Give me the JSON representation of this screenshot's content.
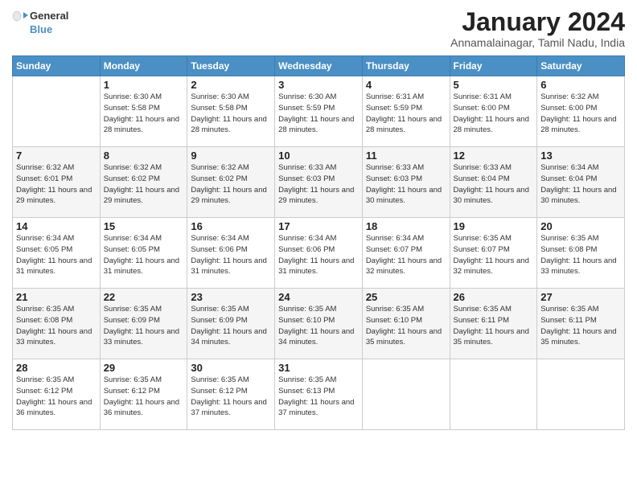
{
  "logo": {
    "line1": "General",
    "line2": "Blue"
  },
  "title": "January 2024",
  "location": "Annamalainagar, Tamil Nadu, India",
  "header": {
    "days": [
      "Sunday",
      "Monday",
      "Tuesday",
      "Wednesday",
      "Thursday",
      "Friday",
      "Saturday"
    ]
  },
  "weeks": [
    [
      {
        "day": "",
        "sunrise": "",
        "sunset": "",
        "daylight": ""
      },
      {
        "day": "1",
        "sunrise": "Sunrise: 6:30 AM",
        "sunset": "Sunset: 5:58 PM",
        "daylight": "Daylight: 11 hours and 28 minutes."
      },
      {
        "day": "2",
        "sunrise": "Sunrise: 6:30 AM",
        "sunset": "Sunset: 5:58 PM",
        "daylight": "Daylight: 11 hours and 28 minutes."
      },
      {
        "day": "3",
        "sunrise": "Sunrise: 6:30 AM",
        "sunset": "Sunset: 5:59 PM",
        "daylight": "Daylight: 11 hours and 28 minutes."
      },
      {
        "day": "4",
        "sunrise": "Sunrise: 6:31 AM",
        "sunset": "Sunset: 5:59 PM",
        "daylight": "Daylight: 11 hours and 28 minutes."
      },
      {
        "day": "5",
        "sunrise": "Sunrise: 6:31 AM",
        "sunset": "Sunset: 6:00 PM",
        "daylight": "Daylight: 11 hours and 28 minutes."
      },
      {
        "day": "6",
        "sunrise": "Sunrise: 6:32 AM",
        "sunset": "Sunset: 6:00 PM",
        "daylight": "Daylight: 11 hours and 28 minutes."
      }
    ],
    [
      {
        "day": "7",
        "sunrise": "Sunrise: 6:32 AM",
        "sunset": "Sunset: 6:01 PM",
        "daylight": "Daylight: 11 hours and 29 minutes."
      },
      {
        "day": "8",
        "sunrise": "Sunrise: 6:32 AM",
        "sunset": "Sunset: 6:02 PM",
        "daylight": "Daylight: 11 hours and 29 minutes."
      },
      {
        "day": "9",
        "sunrise": "Sunrise: 6:32 AM",
        "sunset": "Sunset: 6:02 PM",
        "daylight": "Daylight: 11 hours and 29 minutes."
      },
      {
        "day": "10",
        "sunrise": "Sunrise: 6:33 AM",
        "sunset": "Sunset: 6:03 PM",
        "daylight": "Daylight: 11 hours and 29 minutes."
      },
      {
        "day": "11",
        "sunrise": "Sunrise: 6:33 AM",
        "sunset": "Sunset: 6:03 PM",
        "daylight": "Daylight: 11 hours and 30 minutes."
      },
      {
        "day": "12",
        "sunrise": "Sunrise: 6:33 AM",
        "sunset": "Sunset: 6:04 PM",
        "daylight": "Daylight: 11 hours and 30 minutes."
      },
      {
        "day": "13",
        "sunrise": "Sunrise: 6:34 AM",
        "sunset": "Sunset: 6:04 PM",
        "daylight": "Daylight: 11 hours and 30 minutes."
      }
    ],
    [
      {
        "day": "14",
        "sunrise": "Sunrise: 6:34 AM",
        "sunset": "Sunset: 6:05 PM",
        "daylight": "Daylight: 11 hours and 31 minutes."
      },
      {
        "day": "15",
        "sunrise": "Sunrise: 6:34 AM",
        "sunset": "Sunset: 6:05 PM",
        "daylight": "Daylight: 11 hours and 31 minutes."
      },
      {
        "day": "16",
        "sunrise": "Sunrise: 6:34 AM",
        "sunset": "Sunset: 6:06 PM",
        "daylight": "Daylight: 11 hours and 31 minutes."
      },
      {
        "day": "17",
        "sunrise": "Sunrise: 6:34 AM",
        "sunset": "Sunset: 6:06 PM",
        "daylight": "Daylight: 11 hours and 31 minutes."
      },
      {
        "day": "18",
        "sunrise": "Sunrise: 6:34 AM",
        "sunset": "Sunset: 6:07 PM",
        "daylight": "Daylight: 11 hours and 32 minutes."
      },
      {
        "day": "19",
        "sunrise": "Sunrise: 6:35 AM",
        "sunset": "Sunset: 6:07 PM",
        "daylight": "Daylight: 11 hours and 32 minutes."
      },
      {
        "day": "20",
        "sunrise": "Sunrise: 6:35 AM",
        "sunset": "Sunset: 6:08 PM",
        "daylight": "Daylight: 11 hours and 33 minutes."
      }
    ],
    [
      {
        "day": "21",
        "sunrise": "Sunrise: 6:35 AM",
        "sunset": "Sunset: 6:08 PM",
        "daylight": "Daylight: 11 hours and 33 minutes."
      },
      {
        "day": "22",
        "sunrise": "Sunrise: 6:35 AM",
        "sunset": "Sunset: 6:09 PM",
        "daylight": "Daylight: 11 hours and 33 minutes."
      },
      {
        "day": "23",
        "sunrise": "Sunrise: 6:35 AM",
        "sunset": "Sunset: 6:09 PM",
        "daylight": "Daylight: 11 hours and 34 minutes."
      },
      {
        "day": "24",
        "sunrise": "Sunrise: 6:35 AM",
        "sunset": "Sunset: 6:10 PM",
        "daylight": "Daylight: 11 hours and 34 minutes."
      },
      {
        "day": "25",
        "sunrise": "Sunrise: 6:35 AM",
        "sunset": "Sunset: 6:10 PM",
        "daylight": "Daylight: 11 hours and 35 minutes."
      },
      {
        "day": "26",
        "sunrise": "Sunrise: 6:35 AM",
        "sunset": "Sunset: 6:11 PM",
        "daylight": "Daylight: 11 hours and 35 minutes."
      },
      {
        "day": "27",
        "sunrise": "Sunrise: 6:35 AM",
        "sunset": "Sunset: 6:11 PM",
        "daylight": "Daylight: 11 hours and 35 minutes."
      }
    ],
    [
      {
        "day": "28",
        "sunrise": "Sunrise: 6:35 AM",
        "sunset": "Sunset: 6:12 PM",
        "daylight": "Daylight: 11 hours and 36 minutes."
      },
      {
        "day": "29",
        "sunrise": "Sunrise: 6:35 AM",
        "sunset": "Sunset: 6:12 PM",
        "daylight": "Daylight: 11 hours and 36 minutes."
      },
      {
        "day": "30",
        "sunrise": "Sunrise: 6:35 AM",
        "sunset": "Sunset: 6:12 PM",
        "daylight": "Daylight: 11 hours and 37 minutes."
      },
      {
        "day": "31",
        "sunrise": "Sunrise: 6:35 AM",
        "sunset": "Sunset: 6:13 PM",
        "daylight": "Daylight: 11 hours and 37 minutes."
      },
      {
        "day": "",
        "sunrise": "",
        "sunset": "",
        "daylight": ""
      },
      {
        "day": "",
        "sunrise": "",
        "sunset": "",
        "daylight": ""
      },
      {
        "day": "",
        "sunrise": "",
        "sunset": "",
        "daylight": ""
      }
    ]
  ]
}
